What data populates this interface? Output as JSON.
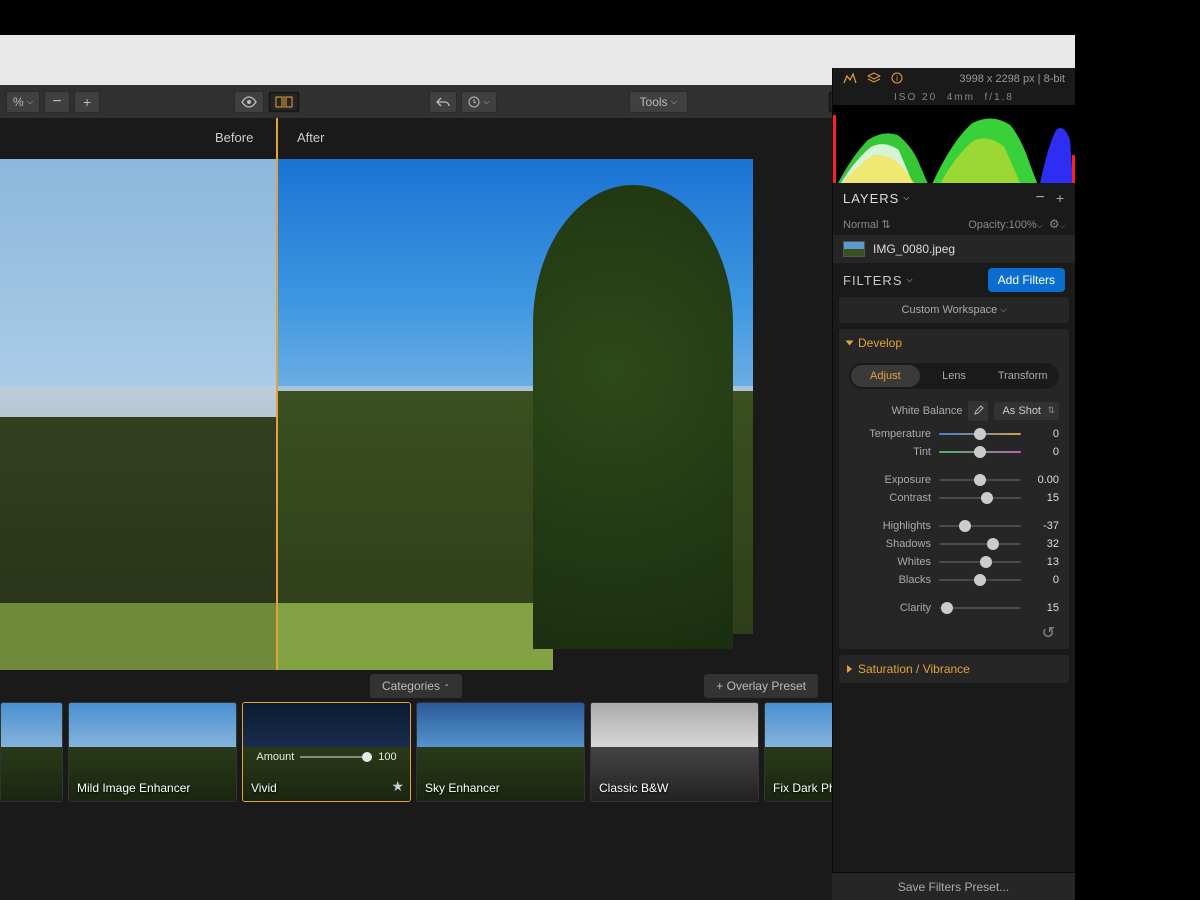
{
  "toolbar": {
    "zoom": "%",
    "tools_label": "Tools",
    "before_label": "Before",
    "after_label": "After"
  },
  "info": {
    "dimensions": "3998 x 2298 px",
    "bitdepth": "8-bit",
    "iso": "ISO 20",
    "focal": "4mm",
    "aperture": "f/1.8"
  },
  "layers": {
    "title": "LAYERS",
    "blend_mode": "Normal",
    "opacity_label": "Opacity:",
    "opacity_value": "100%",
    "item_name": "IMG_0080.jpeg"
  },
  "filters": {
    "title": "FILTERS",
    "add_label": "Add Filters",
    "workspace": "Custom Workspace"
  },
  "develop": {
    "title": "Develop",
    "tabs": {
      "adjust": "Adjust",
      "lens": "Lens",
      "transform": "Transform"
    },
    "wb_label": "White Balance",
    "wb_mode": "As Shot",
    "sliders": {
      "temperature": {
        "label": "Temperature",
        "value": "0",
        "pos": 50
      },
      "tint": {
        "label": "Tint",
        "value": "0",
        "pos": 50
      },
      "exposure": {
        "label": "Exposure",
        "value": "0.00",
        "pos": 50
      },
      "contrast": {
        "label": "Contrast",
        "value": "15",
        "pos": 58
      },
      "highlights": {
        "label": "Highlights",
        "value": "-37",
        "pos": 32
      },
      "shadows": {
        "label": "Shadows",
        "value": "32",
        "pos": 66
      },
      "whites": {
        "label": "Whites",
        "value": "13",
        "pos": 57
      },
      "blacks": {
        "label": "Blacks",
        "value": "0",
        "pos": 50
      },
      "clarity": {
        "label": "Clarity",
        "value": "15",
        "pos": 10
      }
    }
  },
  "sat": {
    "title": "Saturation / Vibrance"
  },
  "presets": {
    "categories_label": "Categories",
    "overlay_label": "+ Overlay Preset",
    "amount_label": "Amount",
    "amount_value": "100",
    "items": [
      {
        "name": "Mild Image Enhancer"
      },
      {
        "name": "Vivid"
      },
      {
        "name": "Sky Enhancer"
      },
      {
        "name": "Classic B&W"
      },
      {
        "name": "Fix Dark Photo"
      }
    ]
  },
  "save_preset": "Save Filters Preset..."
}
